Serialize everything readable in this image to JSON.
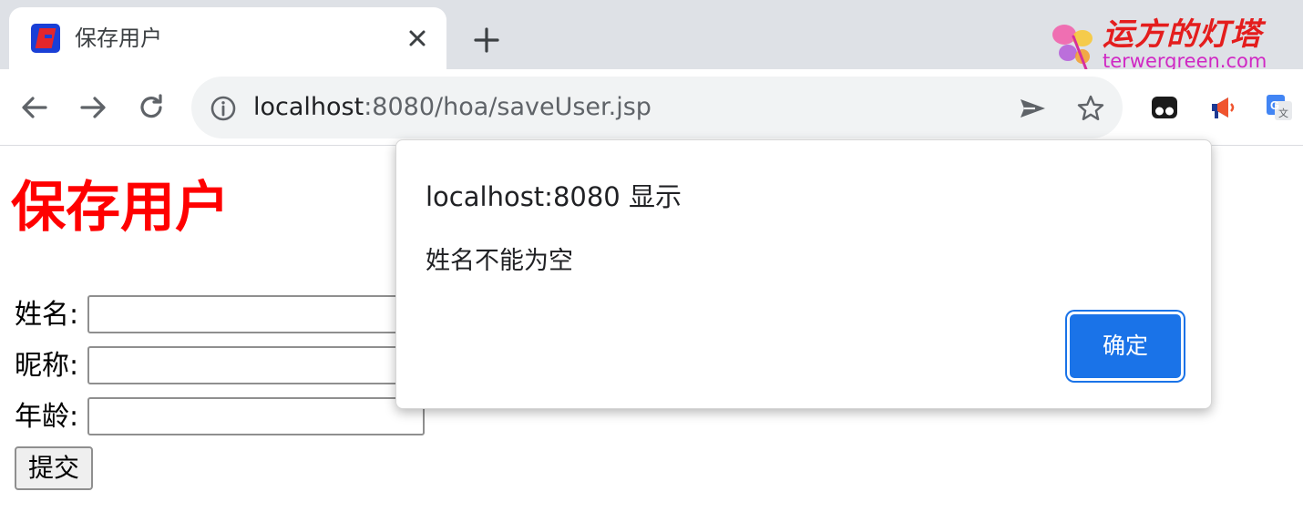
{
  "tab": {
    "title": "保存用户",
    "close_icon": "close-icon",
    "new_tab_icon": "plus-icon"
  },
  "watermark": {
    "chinese": "运方的灯塔",
    "site": "terwergreen.com"
  },
  "toolbar": {
    "back_icon": "arrow-left-icon",
    "forward_icon": "arrow-right-icon",
    "reload_icon": "reload-icon",
    "url_host": "localhost",
    "url_rest": ":8080/hoa/saveUser.jsp",
    "extensions": [
      "tampermonkey-icon",
      "megaphone-icon",
      "google-translate-icon"
    ]
  },
  "page": {
    "title": "保存用户",
    "form": {
      "fields": [
        {
          "label": "姓名:",
          "value": ""
        },
        {
          "label": "昵称:",
          "value": ""
        },
        {
          "label": "年龄:",
          "value": ""
        }
      ],
      "submit_label": "提交"
    }
  },
  "dialog": {
    "title": "localhost:8080 显示",
    "message": "姓名不能为空",
    "ok_label": "确定"
  },
  "colors": {
    "accent": "#1a73e8",
    "page_title": "#ff0000",
    "tabstrip": "#dee1e6",
    "omnibox": "#f1f3f4"
  }
}
